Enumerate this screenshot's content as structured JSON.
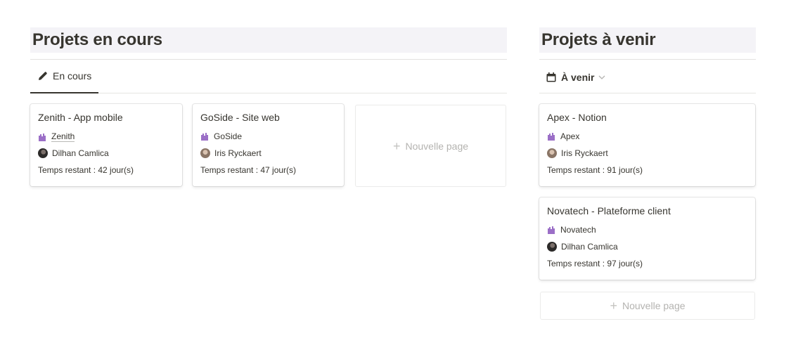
{
  "left": {
    "heading": "Projets en cours",
    "view_tab": {
      "label": "En cours",
      "icon": "pencil-icon"
    },
    "cards": [
      {
        "title": "Zenith - App mobile",
        "client": "Zenith",
        "person": "Dilhan Camlica",
        "time": "Temps restant : 42 jour(s)",
        "avatar": "dark"
      },
      {
        "title": "GoSide - Site web",
        "client": "GoSide",
        "person": "Iris Ryckaert",
        "time": "Temps restant : 47 jour(s)",
        "avatar": "light"
      }
    ],
    "new_page": "Nouvelle page"
  },
  "right": {
    "heading": "Projets à venir",
    "view_tab": {
      "label": "À venir",
      "icon": "calendar-icon"
    },
    "cards": [
      {
        "title": "Apex - Notion",
        "client": "Apex",
        "person": "Iris Ryckaert",
        "time": "Temps restant : 91 jour(s)",
        "avatar": "light"
      },
      {
        "title": "Novatech - Plateforme client",
        "client": "Novatech",
        "person": "Dilhan Camlica",
        "time": "Temps restant : 97 jour(s)",
        "avatar": "dark"
      }
    ],
    "new_page": "Nouvelle page"
  },
  "colors": {
    "tag_icon": "#9b6fc7",
    "heading_bg": "#f4f3f7",
    "text": "#37352f",
    "muted": "#b4b3b0"
  }
}
